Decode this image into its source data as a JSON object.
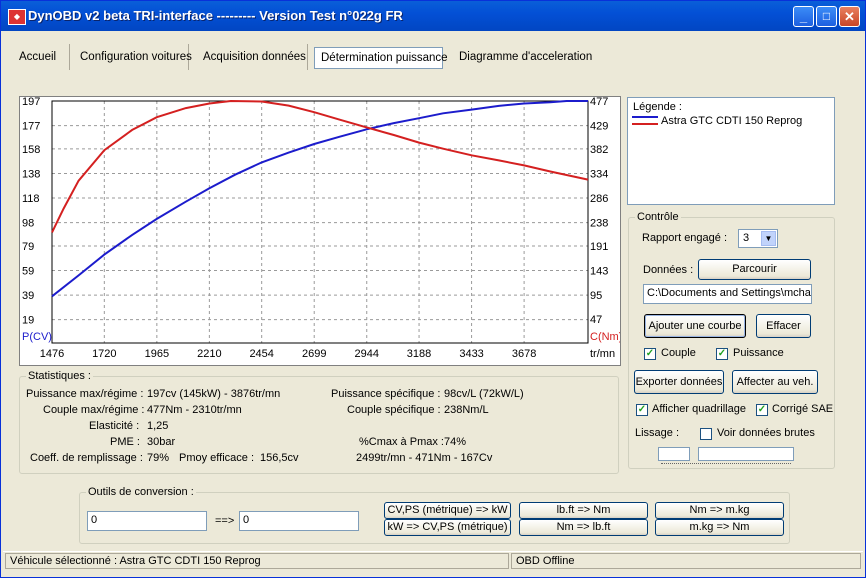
{
  "window": {
    "title": "DynOBD v2 beta TRI-interface --------- Version Test n°022g FR",
    "icon": "app-icon"
  },
  "titlebar": {
    "minimize": "_",
    "maximize": "□",
    "close": "✕"
  },
  "tabs": [
    {
      "label": "Accueil"
    },
    {
      "label": "Configuration voitures"
    },
    {
      "label": "Acquisition données"
    },
    {
      "label": "Détermination puissance",
      "active": true
    },
    {
      "label": "Diagramme d'acceleration"
    }
  ],
  "chart_data": {
    "type": "line",
    "left_axis": {
      "label": "P(CV)",
      "ticks": [
        "197",
        "177",
        "158",
        "138",
        "118",
        "98",
        "79",
        "59",
        "39",
        "19"
      ],
      "ylim": [
        0,
        197
      ]
    },
    "right_axis": {
      "label": "C(Nm)",
      "ticks": [
        "477",
        "429",
        "382",
        "334",
        "286",
        "238",
        "191",
        "143",
        "95",
        "47"
      ],
      "ylim": [
        0,
        477
      ]
    },
    "x_axis": {
      "label": "tr/mn",
      "ticks": [
        "1476",
        "1720",
        "1965",
        "2210",
        "2454",
        "2699",
        "2944",
        "3188",
        "3433",
        "3678"
      ],
      "xlim": [
        1476,
        3976
      ]
    },
    "grid": true,
    "series": [
      {
        "name": "Puissance",
        "color": "#1c1ccc",
        "axis": "left",
        "x": [
          1476,
          1600,
          1720,
          1850,
          1965,
          2100,
          2210,
          2330,
          2454,
          2580,
          2699,
          2820,
          2944,
          3070,
          3188,
          3300,
          3433,
          3560,
          3678,
          3800,
          3876,
          3976
        ],
        "y": [
          38,
          55,
          72,
          88,
          101,
          115,
          126,
          137,
          147,
          155,
          162,
          168,
          174,
          179,
          183,
          187,
          190,
          193,
          195,
          196,
          197,
          197
        ]
      },
      {
        "name": "Couple",
        "color": "#d42020",
        "axis": "right",
        "x": [
          1476,
          1530,
          1600,
          1720,
          1850,
          1965,
          2100,
          2210,
          2310,
          2454,
          2580,
          2699,
          2820,
          2944,
          3070,
          3188,
          3300,
          3433,
          3560,
          3678,
          3800,
          3976
        ],
        "y": [
          218,
          265,
          320,
          380,
          420,
          445,
          463,
          472,
          477,
          476,
          468,
          455,
          440,
          425,
          410,
          395,
          383,
          370,
          360,
          350,
          338,
          322
        ]
      }
    ]
  },
  "legend": {
    "title": "Légende :",
    "entry": "Astra GTC CDTI 150 Reprog",
    "color": "#d42020"
  },
  "controle": {
    "title": "Contrôle",
    "rapport_label": "Rapport engagé :",
    "rapport_value": "3",
    "donnees_label": "Données :",
    "parcourir": "Parcourir",
    "path": "C:\\Documents and Settings\\mcha",
    "ajouter": "Ajouter une courbe",
    "effacer": "Effacer",
    "couple": "Couple",
    "puissance": "Puissance",
    "exporter": "Exporter données",
    "affecter": "Affecter au veh.",
    "quadrillage": "Afficher quadrillage",
    "sae": "Corrigé SAE",
    "lissage": "Lissage :",
    "brutes": "Voir données brutes"
  },
  "stats": {
    "title": "Statistiques :",
    "pmax_label": "Puissance max/régime :",
    "pmax_value": "197cv (145kW) - 3876tr/mn",
    "cmax_label": "Couple max/régime :",
    "cmax_value": "477Nm - 2310tr/mn",
    "elast_label": "Elasticité :",
    "elast_value": "1,25",
    "pme_label": "PME :",
    "pme_value": "30bar",
    "coeff_label": "Coeff. de remplissage :",
    "coeff_value": "79%",
    "pmoy_label": "Pmoy efficace :",
    "pmoy_value": "156,5cv",
    "pspec_label": "Puissance spécifique :",
    "pspec_value": "98cv/L (72kW/L)",
    "cspec_label": "Couple spécifique :",
    "cspec_value": "238Nm/L",
    "ratio_label": "%Cmax à Pmax :",
    "ratio_value": "74%",
    "ratio_detail": "2499tr/mn - 471Nm - 167Cv"
  },
  "outils": {
    "title": "Outils de conversion :",
    "input_value": "0",
    "arrow": "==>",
    "output_value": "0",
    "b1": "CV,PS (métrique) => kW",
    "b2": "kW => CV,PS (métrique)",
    "b3": "lb.ft => Nm",
    "b4": "Nm => lb.ft",
    "b5": "Nm => m.kg",
    "b6": "m.kg => Nm"
  },
  "status": {
    "vehicle": "Véhicule sélectionné : Astra GTC CDTI 150 Reprog",
    "obd": "OBD Offline"
  }
}
